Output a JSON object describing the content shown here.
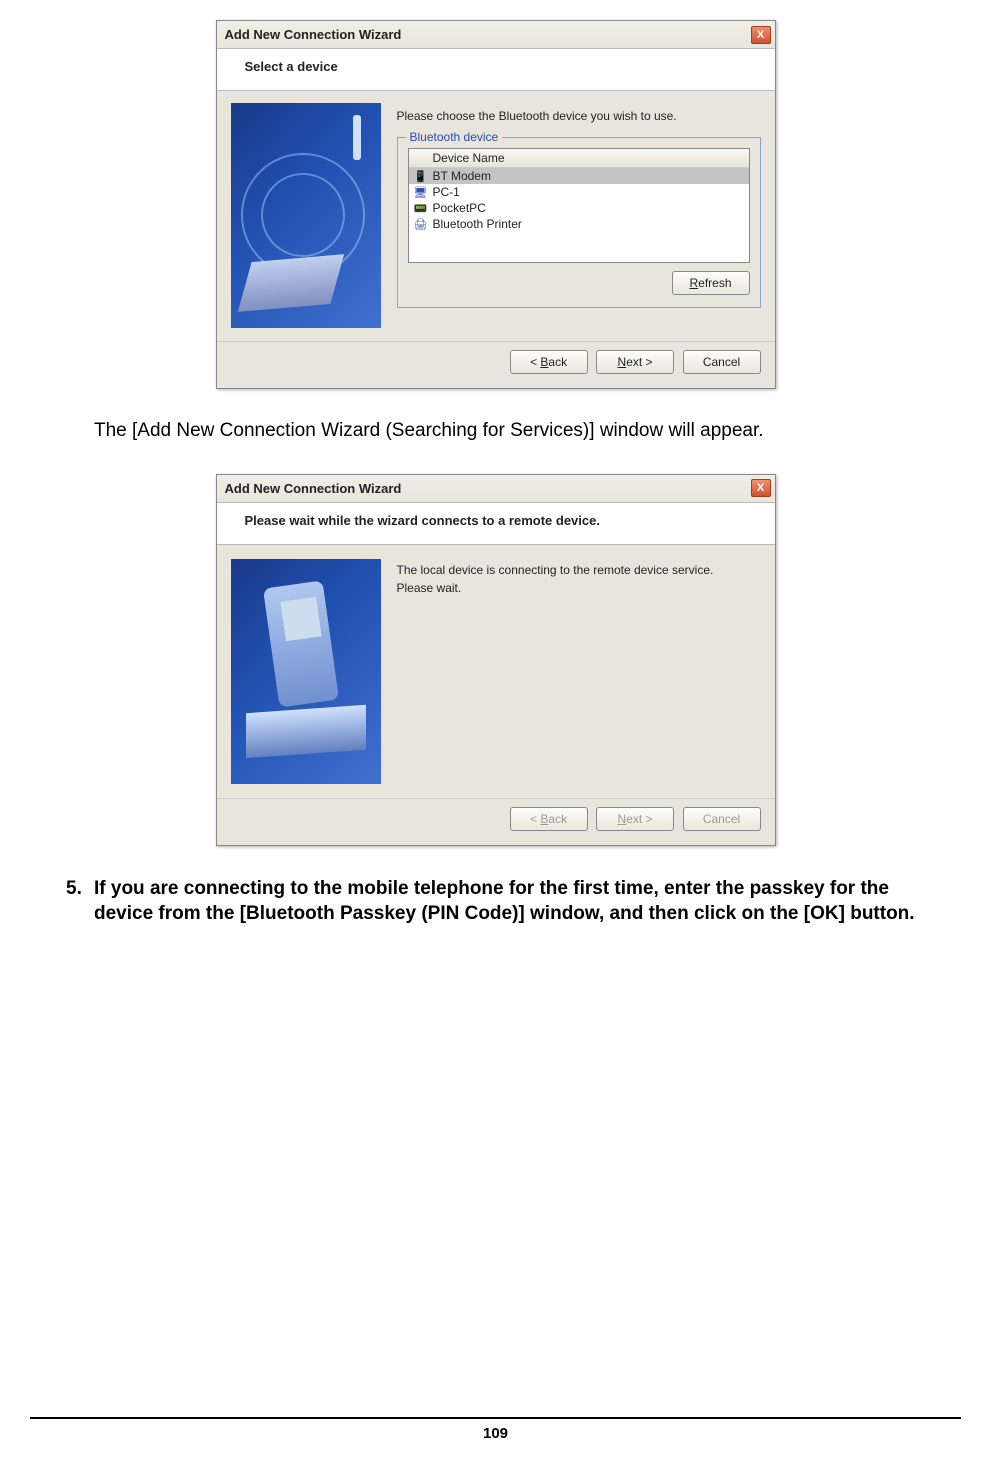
{
  "wizard1": {
    "title": "Add New Connection Wizard",
    "header_main": "Select a device",
    "instruction": "Please choose the Bluetooth device you wish to use.",
    "group_label": "Bluetooth device",
    "list_header": "Device Name",
    "devices": [
      {
        "name": "BT Modem",
        "icon": "phone-icon",
        "selected": true
      },
      {
        "name": "PC-1",
        "icon": "monitor-icon",
        "selected": false
      },
      {
        "name": "PocketPC",
        "icon": "pda-icon",
        "selected": false
      },
      {
        "name": "Bluetooth Printer",
        "icon": "printer-icon",
        "selected": false
      }
    ],
    "refresh_label": "Refresh",
    "back_label": "< Back",
    "next_label": "Next >",
    "cancel_label": "Cancel"
  },
  "doc": {
    "para1": "The [Add New Connection Wizard (Searching for Services)] window will appear."
  },
  "wizard2": {
    "title": "Add New Connection Wizard",
    "header_sub": "Please wait while the wizard connects to a remote device.",
    "msg_line1": "The local device is connecting to the remote device service.",
    "msg_line2": "Please wait.",
    "back_label": "< Back",
    "next_label": "Next >",
    "cancel_label": "Cancel"
  },
  "step5": {
    "number": "5.",
    "text": "If you are connecting to the mobile telephone for the first time, enter the passkey for the device from the [Bluetooth Passkey (PIN Code)] window, and then click on the [OK] button."
  },
  "page_number": "109"
}
